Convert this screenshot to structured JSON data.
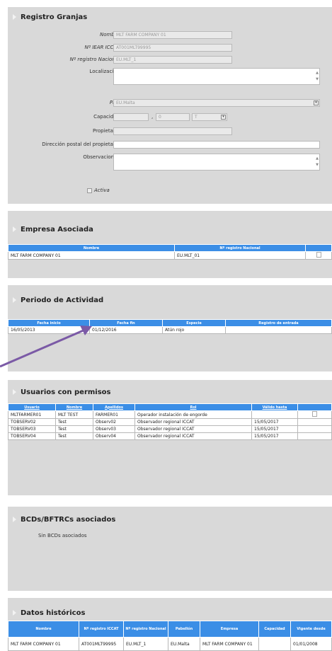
{
  "registro": {
    "title": "Registro Granjas",
    "fields": {
      "nombre": {
        "label": "Nombre",
        "value": "MLT FARM COMPANY 01"
      },
      "iear": {
        "label": "Nº IEAR ICCAT",
        "value": "AT001MLT99995"
      },
      "registro_nacional": {
        "label": "Nº registro Nacional",
        "value": "EU.MLT_1"
      },
      "localizacion": {
        "label": "Localización",
        "value": ""
      },
      "pais": {
        "label": "País",
        "value": "EU.Malta"
      },
      "capacidad": {
        "label": "Capacidad",
        "value1": "",
        "sep": ",",
        "value2": "0",
        "value3": "T"
      },
      "propietario": {
        "label": "Propietario",
        "value": ""
      },
      "direccion": {
        "label": "Dirección postal del propietario",
        "value": ""
      },
      "observaciones": {
        "label": "Observaciones",
        "value": ""
      }
    },
    "activa_label": "Activa"
  },
  "empresa": {
    "title": "Empresa Asociada",
    "headers": [
      "Nombre",
      "Nº registro Nacional"
    ],
    "rows": [
      [
        "MLT FARM COMPANY 01",
        "EU.MLT_01"
      ]
    ]
  },
  "periodo": {
    "title": "Periodo de Actividad",
    "headers": [
      "Fecha inicio",
      "Fecha fin",
      "Especie",
      "Registro de entrada"
    ],
    "rows": [
      [
        "16/05/2013",
        "01/12/2016",
        "Atún rojo",
        ""
      ]
    ]
  },
  "usuarios": {
    "title": "Usuarios con permisos",
    "headers": [
      "Usuario",
      "Nombre",
      "Apellidos",
      "Rol",
      "Válido hasta"
    ],
    "rows": [
      [
        "MLTFARMER01",
        "MLT TEST",
        "FARMER01",
        "Operador instalación de engorde",
        ""
      ],
      [
        "TOBSERV02",
        "Test",
        "Observ02",
        "Observador regional ICCAT",
        "15/05/2017"
      ],
      [
        "TOBSERV03",
        "Test",
        "Observ03",
        "Observador regional ICCAT",
        "15/05/2017"
      ],
      [
        "TOBSERV04",
        "Test",
        "Observ04",
        "Observador regional ICCAT",
        "15/05/2017"
      ]
    ]
  },
  "bcds": {
    "title": "BCDs/BFTRCs asociados",
    "empty_text": "Sin BCDs asociados"
  },
  "historicos": {
    "title": "Datos históricos",
    "headers": [
      "Nombre",
      "Nº registro ICCAT",
      "Nº registro Nacional",
      "Pabellón",
      "Empresa",
      "Capacidad",
      "Vigente desde"
    ],
    "rows": [
      [
        "MLT FARM COMPANY 01",
        "AT001MLT99995",
        "EU.MLT_1",
        "EU.Malta",
        "MLT FARM COMPANY 01",
        "",
        "01/01/2008"
      ]
    ]
  },
  "colors": {
    "panel": "#d9d9d9",
    "header_blue": "#3b8ee6",
    "arrow": "#7b5aa6"
  }
}
